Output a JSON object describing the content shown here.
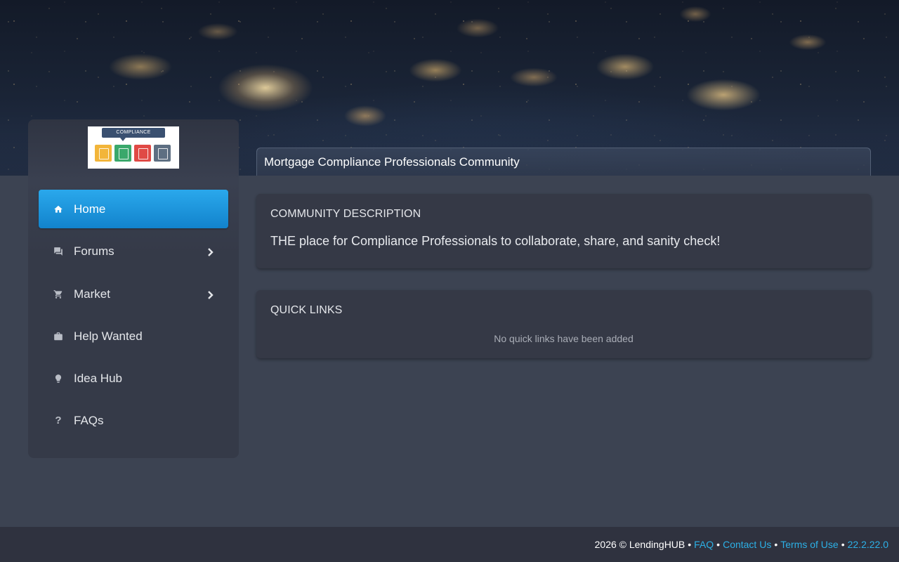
{
  "header": {
    "title": "Mortgage Compliance Professionals Community"
  },
  "logo": {
    "text": "COMPLIANCE"
  },
  "sidebar": {
    "items": [
      {
        "label": "Home",
        "icon": "home-icon",
        "active": true,
        "has_submenu": false
      },
      {
        "label": "Forums",
        "icon": "forum-icon",
        "active": false,
        "has_submenu": true
      },
      {
        "label": "Market",
        "icon": "cart-icon",
        "active": false,
        "has_submenu": true
      },
      {
        "label": "Help Wanted",
        "icon": "briefcase-icon",
        "active": false,
        "has_submenu": false
      },
      {
        "label": "Idea Hub",
        "icon": "lightbulb-icon",
        "active": false,
        "has_submenu": false
      },
      {
        "label": "FAQs",
        "icon": "question-icon",
        "active": false,
        "has_submenu": false
      }
    ]
  },
  "description_card": {
    "title": "COMMUNITY DESCRIPTION",
    "text": "THE place for Compliance Professionals to collaborate, share, and sanity check!"
  },
  "quick_links_card": {
    "title": "QUICK LINKS",
    "empty_text": "No quick links have been added"
  },
  "footer": {
    "copyright": "2026 © LendingHUB",
    "separator": "•",
    "links": [
      {
        "label": "FAQ"
      },
      {
        "label": "Contact Us"
      },
      {
        "label": "Terms of Use"
      },
      {
        "label": "22.2.22.0"
      }
    ]
  },
  "colors": {
    "accent": "#1a95dd",
    "link": "#2cb0e6",
    "page_bg": "#3c4352",
    "card_bg": "#353946",
    "footer_bg": "#2f323f"
  }
}
